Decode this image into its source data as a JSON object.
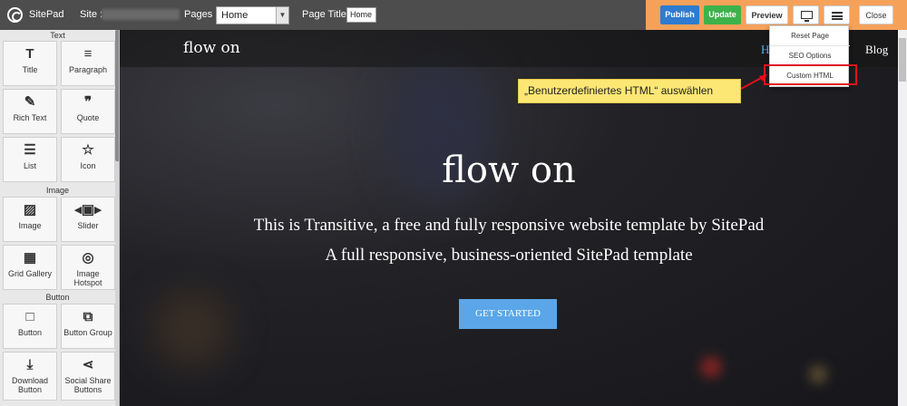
{
  "topbar": {
    "brand": "SitePad",
    "site_label": "Site :",
    "pages_label": "Pages :",
    "pages_value": "Home",
    "page_title_label": "Page Title:",
    "page_title_value": "Home",
    "publish_label": "Publish",
    "update_label": "Update",
    "preview_label": "Preview",
    "close_label": "Close",
    "accent_color": "#f5a15a"
  },
  "sidebar": {
    "sections": [
      "Text",
      "Image",
      "Button"
    ],
    "widgets": [
      {
        "label": "Title",
        "icon": "title-icon"
      },
      {
        "label": "Paragraph",
        "icon": "paragraph-icon"
      },
      {
        "label": "Rich Text",
        "icon": "rich-text-icon"
      },
      {
        "label": "Quote",
        "icon": "quote-icon"
      },
      {
        "label": "List",
        "icon": "list-icon"
      },
      {
        "label": "Icon",
        "icon": "star-icon"
      },
      {
        "label": "Image",
        "icon": "image-icon"
      },
      {
        "label": "Slider",
        "icon": "slider-icon"
      },
      {
        "label": "Grid Gallery",
        "icon": "grid-icon"
      },
      {
        "label": "Image Hotspot",
        "icon": "hotspot-icon"
      },
      {
        "label": "Button",
        "icon": "button-icon"
      },
      {
        "label": "Button Group",
        "icon": "button-group-icon"
      },
      {
        "label": "Download Button",
        "icon": "download-icon"
      },
      {
        "label": "Social Share Buttons",
        "icon": "share-icon"
      }
    ]
  },
  "preview": {
    "site_brand": "flow on",
    "nav_partial": "H",
    "nav_blog": "Blog",
    "hero_title": "flow on",
    "hero_sub1": "This is Transitive, a free and fully responsive website template by SitePad",
    "hero_sub2": "A full responsive, business-oriented SitePad template",
    "cta_label": "GET STARTED"
  },
  "menu": {
    "items": [
      "Reset Page",
      "SEO Options",
      "Custom HTML"
    ],
    "highlighted": "Custom HTML"
  },
  "callout": {
    "text": "„Benutzerdefiniertes HTML“ auswählen",
    "color": "#fde774"
  }
}
